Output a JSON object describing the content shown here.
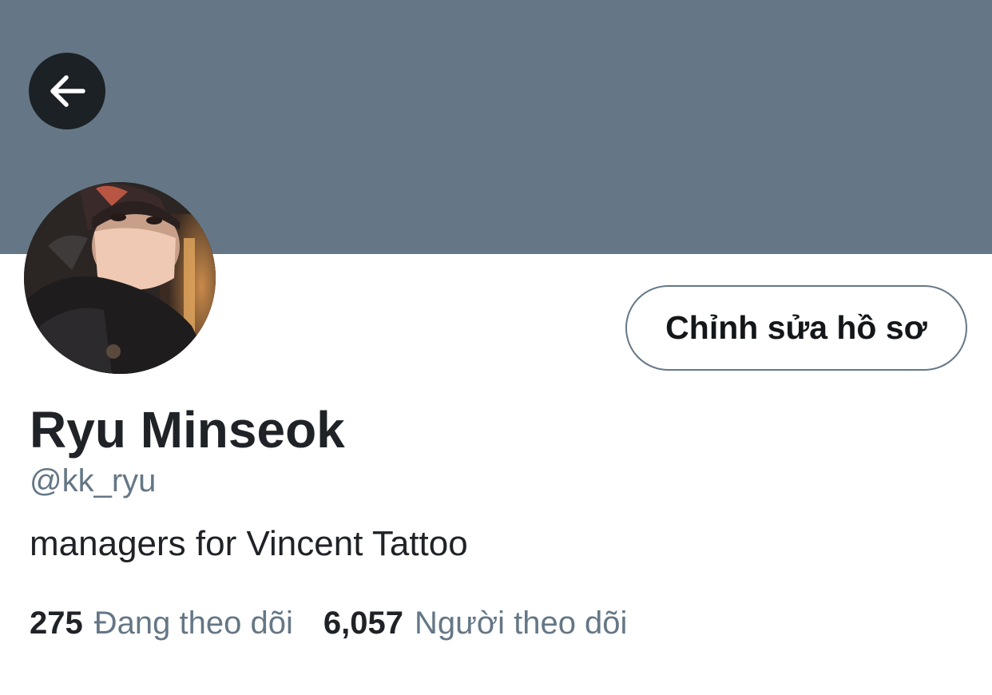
{
  "profile": {
    "edit_button_label": "Chỉnh sửa hồ sơ",
    "display_name": "Ryu Minseok",
    "handle": "@kk_ryu",
    "bio": "managers for Vincent Tattoo"
  },
  "stats": {
    "following_count": "275",
    "following_label": "Đang theo dõi",
    "followers_count": "6,057",
    "followers_label": "Người theo dõi"
  },
  "icons": {
    "back": "arrow-left-icon"
  },
  "colors": {
    "banner": "#657786",
    "back_button_bg": "#1c2125",
    "secondary_text": "#657786",
    "primary_text": "#1f2226",
    "button_border": "#657786"
  }
}
